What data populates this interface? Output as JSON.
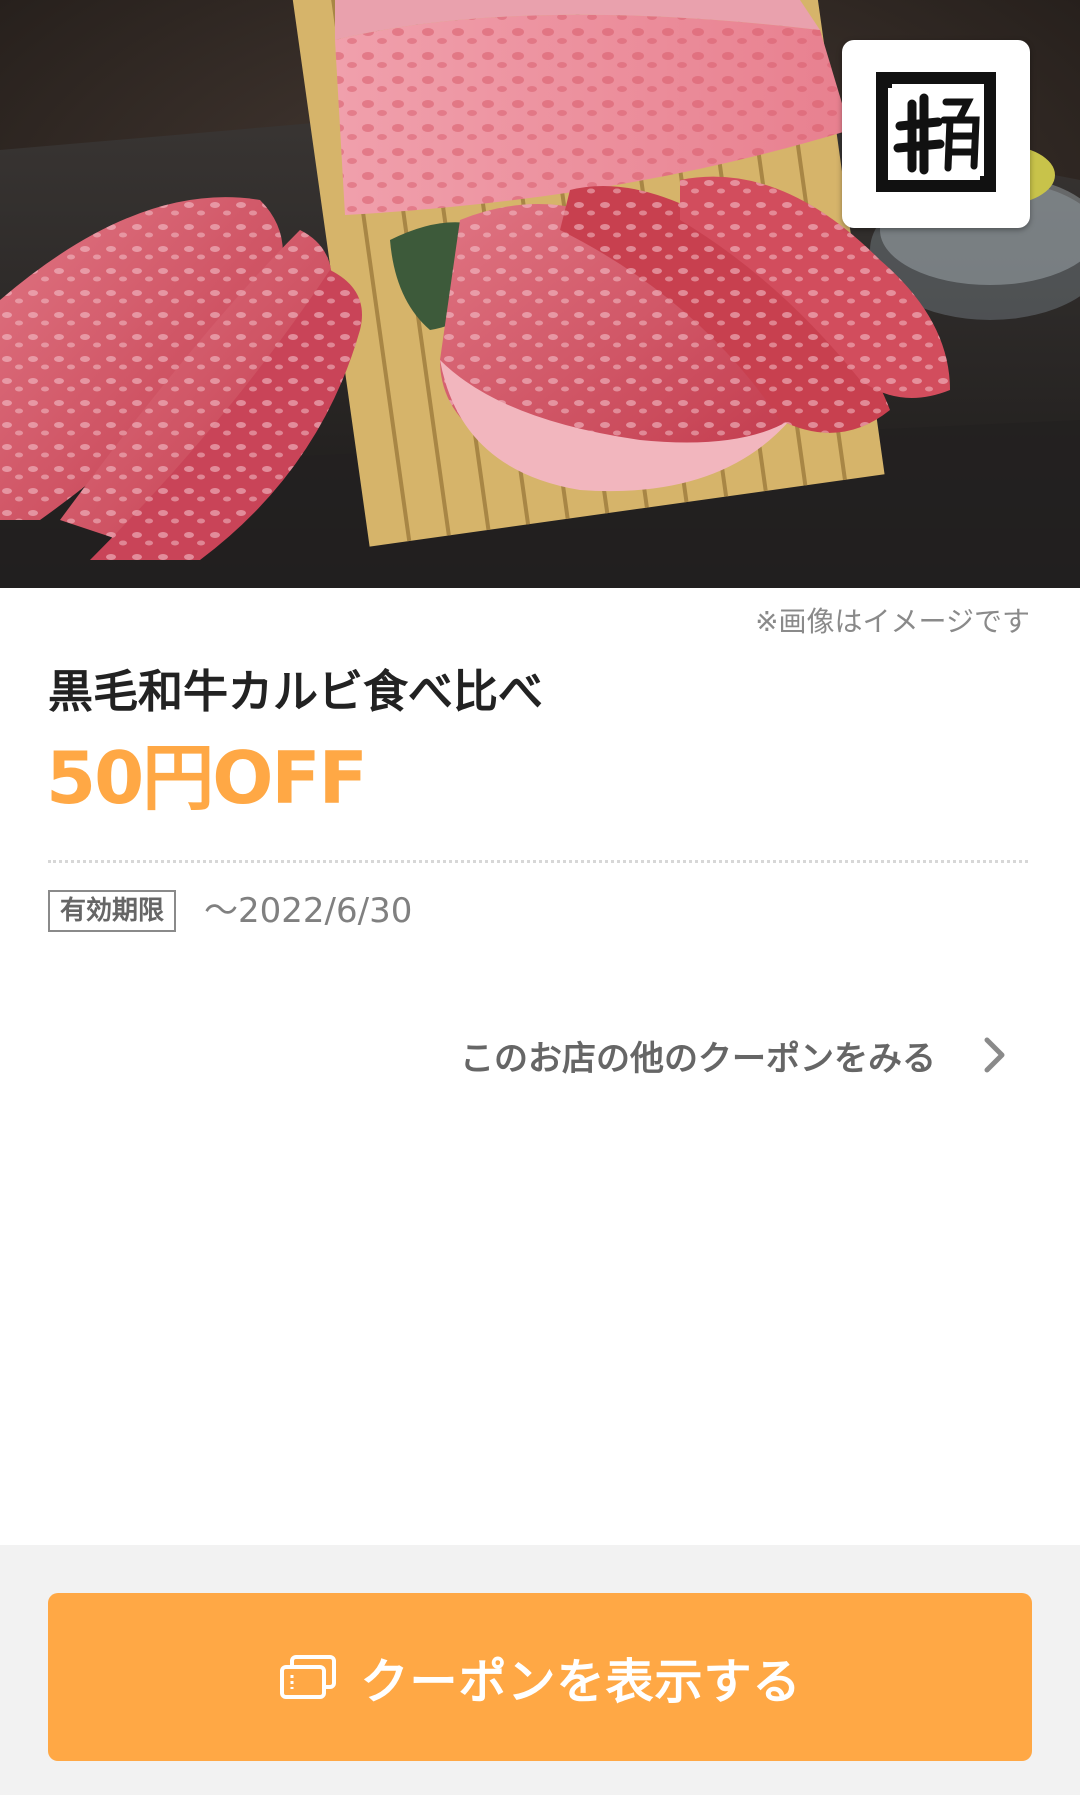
{
  "hero": {
    "image_description": "wagyu-beef-plate-photo",
    "logo_icon": "gyukaku-logo-icon"
  },
  "coupon": {
    "image_note": "※画像はイメージです",
    "title": "黒毛和牛カルビ食べ比べ",
    "discount": "50円OFF",
    "validity_label": "有効期限",
    "validity_date": "〜2022/6/30",
    "other_coupons_link": "このお店の他のクーポンをみる"
  },
  "footer": {
    "button_label": "クーポンを表示する",
    "button_icon": "coupon-cards-icon"
  },
  "colors": {
    "accent": "#ffa845",
    "footer_bg": "#f2f2f2",
    "title_text": "#222222",
    "muted_text": "#808080"
  }
}
